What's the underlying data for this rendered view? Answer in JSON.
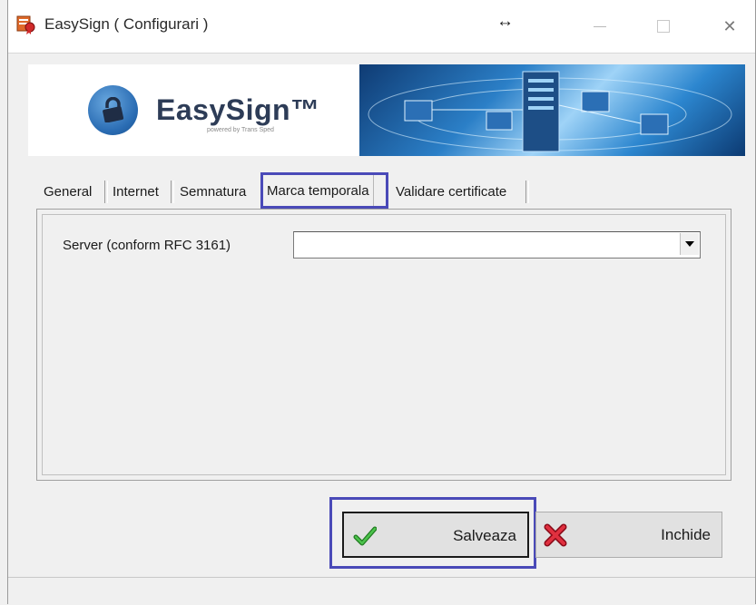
{
  "window": {
    "title": "EasySign ( Configurari )",
    "resize_indicator": "↔",
    "minimize_label": "",
    "close_glyph": "✕"
  },
  "banner": {
    "logo_text": "EasySign™",
    "logo_subtitle": "powered by Trans Sped"
  },
  "tabs": [
    {
      "label": "General",
      "active": false
    },
    {
      "label": "Internet",
      "active": false
    },
    {
      "label": "Semnatura",
      "active": false
    },
    {
      "label": "Marca temporala",
      "active": true
    },
    {
      "label": "Validare certificate",
      "active": false
    }
  ],
  "panel": {
    "server_label": "Server (conform RFC 3161)",
    "server_value": ""
  },
  "buttons": {
    "save_label": "Salveaza",
    "close_label": "Inchide"
  },
  "colors": {
    "highlight": "#4a4ab8",
    "save_check": "#2e9a2e",
    "close_x": "#d02030"
  }
}
